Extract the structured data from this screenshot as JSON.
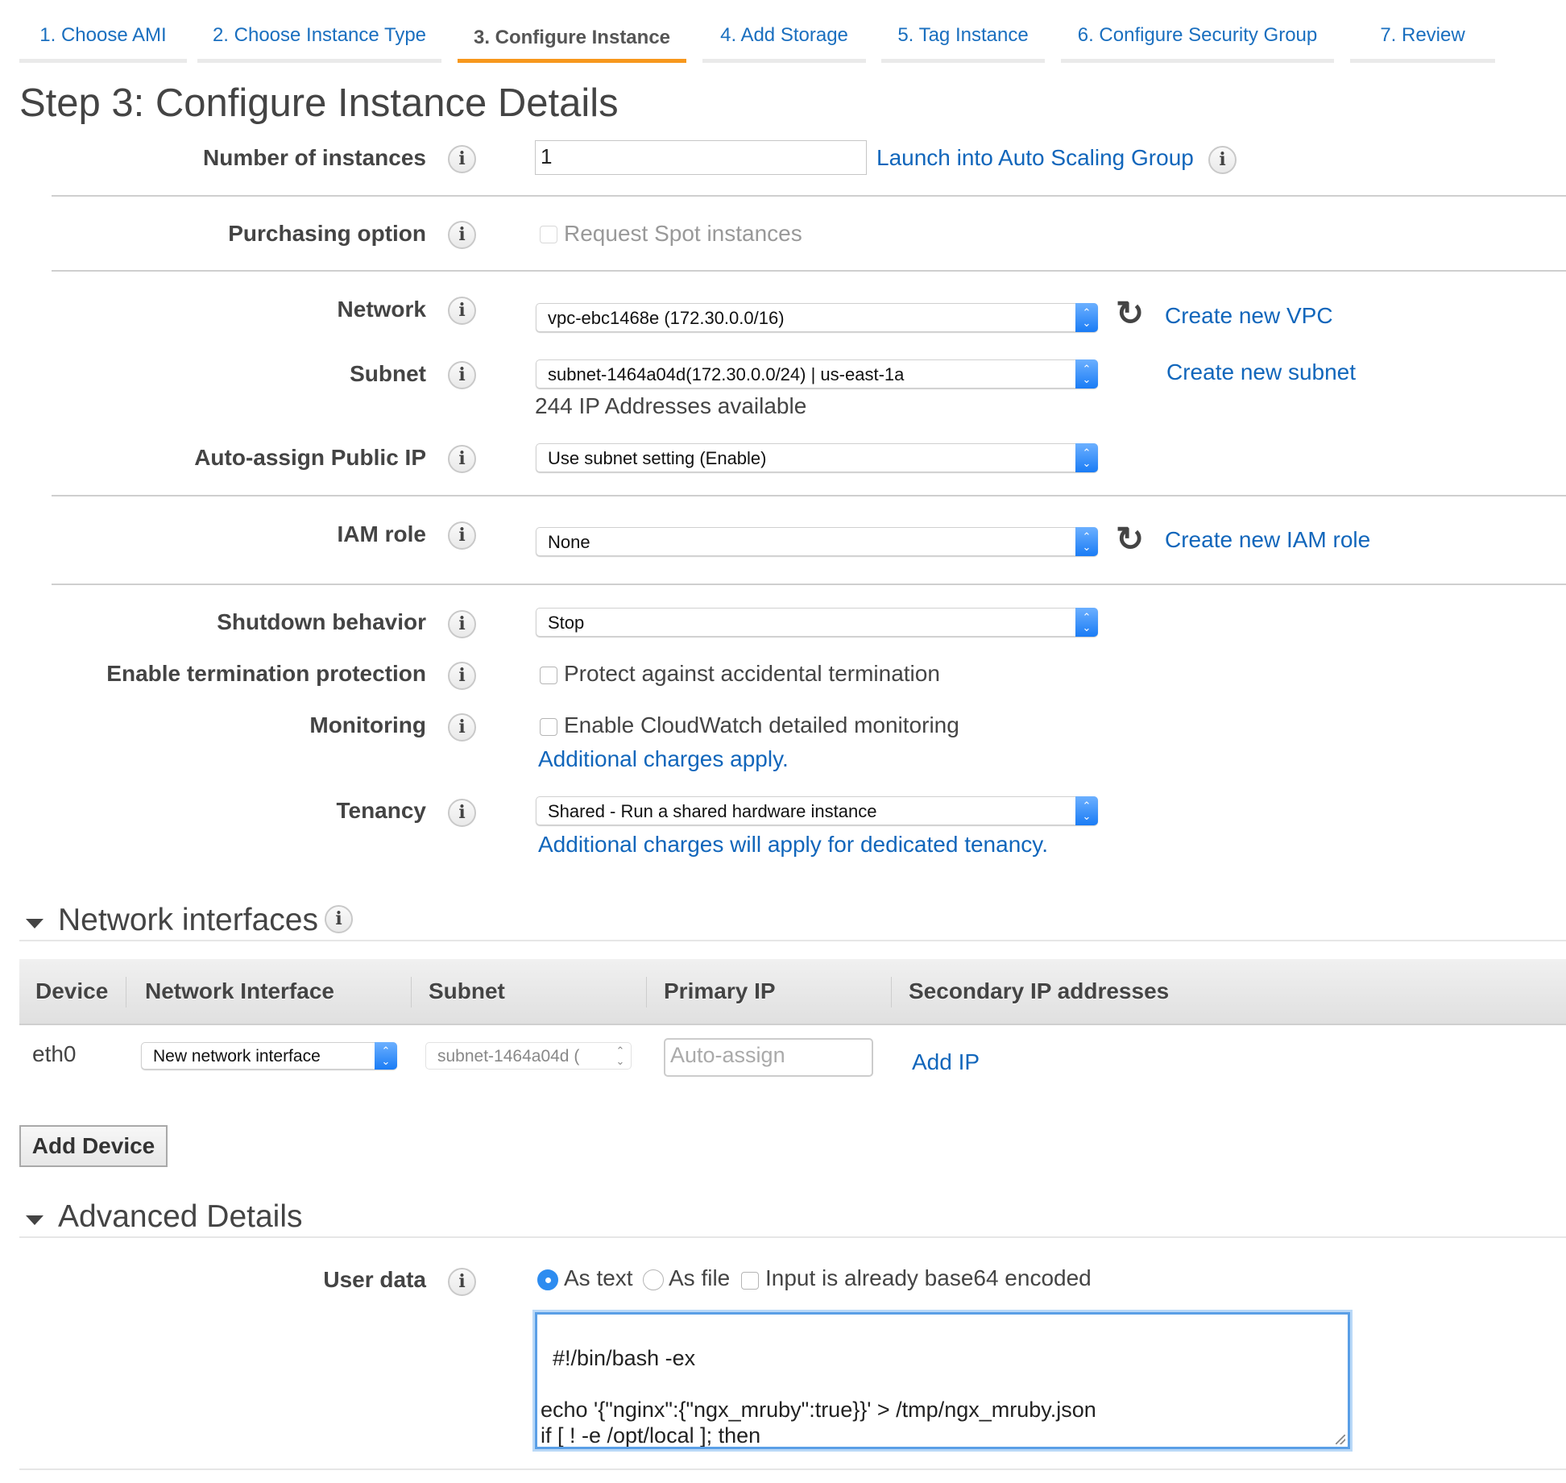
{
  "tabs": [
    {
      "label": "1. Choose AMI",
      "active": false
    },
    {
      "label": "2. Choose Instance Type",
      "active": false
    },
    {
      "label": "3. Configure Instance",
      "active": true
    },
    {
      "label": "4. Add Storage",
      "active": false
    },
    {
      "label": "5. Tag Instance",
      "active": false
    },
    {
      "label": "6. Configure Security Group",
      "active": false
    },
    {
      "label": "7. Review",
      "active": false
    }
  ],
  "page_title": "Step 3: Configure Instance Details",
  "info_glyph": "i",
  "refresh_glyph": "↻",
  "fields": {
    "num_instances": {
      "label": "Number of instances",
      "value": "1",
      "link": "Launch into Auto Scaling Group"
    },
    "purchasing": {
      "label": "Purchasing option",
      "checkbox_label": "Request Spot instances",
      "checked": false
    },
    "network": {
      "label": "Network",
      "value": "vpc-ebc1468e (172.30.0.0/16)",
      "link": "Create new VPC"
    },
    "subnet": {
      "label": "Subnet",
      "value": "subnet-1464a04d(172.30.0.0/24) | us-east-1a",
      "link": "Create new subnet",
      "note": "244 IP Addresses available"
    },
    "public_ip": {
      "label": "Auto-assign Public IP",
      "value": "Use subnet setting (Enable)"
    },
    "iam_role": {
      "label": "IAM role",
      "value": "None",
      "link": "Create new IAM role"
    },
    "shutdown": {
      "label": "Shutdown behavior",
      "value": "Stop"
    },
    "termination": {
      "label": "Enable termination protection",
      "checkbox_label": "Protect against accidental termination",
      "checked": false
    },
    "monitoring": {
      "label": "Monitoring",
      "checkbox_label": "Enable CloudWatch detailed monitoring",
      "checked": false,
      "link": "Additional charges apply."
    },
    "tenancy": {
      "label": "Tenancy",
      "value": "Shared - Run a shared hardware instance",
      "link": "Additional charges will apply for dedicated tenancy."
    }
  },
  "network_interfaces": {
    "title": "Network interfaces",
    "columns": [
      "Device",
      "Network Interface",
      "Subnet",
      "Primary IP",
      "Secondary IP addresses"
    ],
    "rows": [
      {
        "device": "eth0",
        "interface": "New network interface",
        "subnet": "subnet-1464a04d (",
        "primary_ip_placeholder": "Auto-assign",
        "add_ip": "Add IP"
      }
    ],
    "add_device": "Add Device"
  },
  "advanced": {
    "title": "Advanced Details",
    "user_data": {
      "label": "User data",
      "options": [
        {
          "label": "As text",
          "selected": true
        },
        {
          "label": "As file",
          "selected": false
        }
      ],
      "base64_label": "Input is already base64 encoded",
      "base64_checked": false,
      "content": "#!/bin/bash -ex\n\necho '{\"nginx\":{\"ngx_mruby\":true}}' > /tmp/ngx_mruby.json\nif [ ! -e /opt/local ]; then\n  /bin/mkdir -p /opt/local"
    }
  },
  "colors": {
    "link": "#1166bb",
    "active_tab": "#f7981d",
    "select_accent": "#1a7cf5",
    "text": "#444444"
  }
}
